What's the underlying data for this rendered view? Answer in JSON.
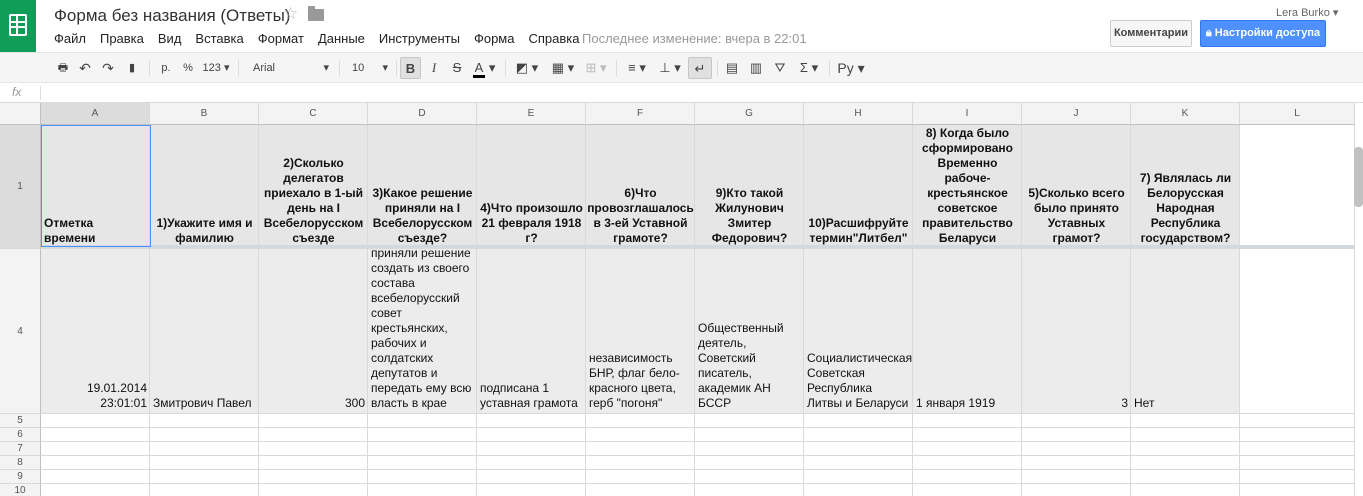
{
  "app": {
    "title": "Форма без названия (Ответы)",
    "user": "Lera Burko ▾",
    "last_edit": "Последнее изменение: вчера в 22:01",
    "comments_label": "Комментарии",
    "share_label": "Настройки доступа",
    "share_color": "#4d90fe"
  },
  "menu": [
    "Файл",
    "Правка",
    "Вид",
    "Вставка",
    "Формат",
    "Данные",
    "Инструменты",
    "Форма",
    "Справка"
  ],
  "toolbar": {
    "currency": "р.",
    "percent": "%",
    "number_format": "123",
    "font": "Arial",
    "font_size": "10",
    "bold": "B",
    "italic": "I",
    "strike": "S",
    "text_color": "A",
    "sigma": "Σ",
    "input_tools": "Ру"
  },
  "formula_bar": {
    "fx": "fx",
    "value": ""
  },
  "columns": [
    "A",
    "B",
    "C",
    "D",
    "E",
    "F",
    "G",
    "H",
    "I",
    "J",
    "K",
    "L"
  ],
  "rows": [
    "1",
    "4",
    "5",
    "6",
    "7",
    "8",
    "9",
    "10"
  ],
  "header_cells": [
    "Отметка времени",
    "1)Укажите имя и фамилию",
    "2)Сколько делегатов приехало в 1-ый день на I Всебелорусском съезде",
    "3)Какое решение приняли на I Всебелорусском съезде?",
    "4)Что произошло 21 февраля 1918 г?",
    "6)Что провозглашалось в 3-ей Уставной грамоте?",
    "9)Кто такой Жилунович Змитер Федорович?",
    "10)Расшифруйте термин\"Литбел\"",
    "8) Когда было сформировано Временно рабоче-крестьянское советское правительство Беларуси",
    "5)Сколько всего было принято Уставных грамот?",
    "7) Являлась ли Белорусская Народная Республика государством?",
    ""
  ],
  "data_cells": [
    "19.01.2014 23:01:01",
    "Змитрович Павел",
    "300",
    "приняли решение создать из своего состава всебелорусский совет крестьянских, рабочих и солдатских депутатов и передать ему всю власть в крае",
    "подписана 1 уставная грамота",
    "независимость БНР, флаг бело-красного цвета, герб \"погоня\"",
    "Общественный деятель, Советский писатель, академик АН БССР",
    "Социалистическая Советская Республика Литвы и Беларуси",
    "1 января 1919",
    "3",
    "Нет",
    ""
  ]
}
